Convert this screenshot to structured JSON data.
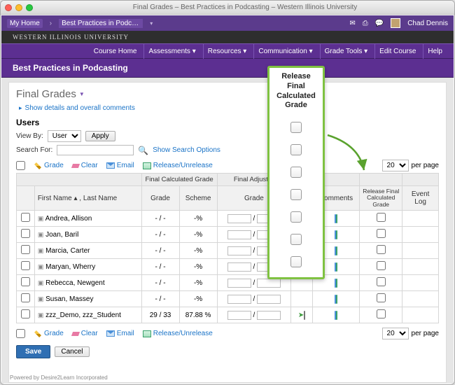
{
  "window_title": "Final Grades – Best Practices in Podcasting – Western Illinois University",
  "topnav": {
    "home": "My Home",
    "breadcrumb": "Best Practices in Podc…",
    "icons": [
      "envelope",
      "chat",
      "speech"
    ],
    "user": "Chad Dennis"
  },
  "university": "WESTERN ILLINOIS UNIVERSITY",
  "navbar2": [
    "Course Home",
    "Assessments ▾",
    "Resources ▾",
    "Communication ▾",
    "Grade Tools ▾",
    "Edit Course",
    "Help"
  ],
  "course_header": "Best Practices in Podcasting",
  "page_title": "Final Grades",
  "show_details": "Show details and overall comments",
  "users_heading": "Users",
  "view_by_label": "View By:",
  "view_by_options": [
    "User"
  ],
  "apply": "Apply",
  "search_for_label": "Search For:",
  "search_value": "",
  "show_search_options": "Show Search Options",
  "tools": {
    "grade": "Grade",
    "clear": "Clear",
    "email": "Email",
    "release": "Release/Unrelease"
  },
  "perpage": {
    "value": "20",
    "suffix": "per page"
  },
  "table": {
    "group_headers": [
      "",
      "Final Calculated Grade",
      "Final Adjusted Grade",
      "",
      "",
      ""
    ],
    "headers": [
      "",
      "First Name ▴ , Last Name",
      "Grade",
      "Scheme",
      "Grade",
      "",
      "Comments",
      "Release Final Calculated Grade",
      "Event Log"
    ],
    "rows": [
      {
        "name": "Andrea, Allison",
        "grade": "- / -",
        "scheme": "-%"
      },
      {
        "name": "Joan, Baril",
        "grade": "- / -",
        "scheme": "-%"
      },
      {
        "name": "Marcia, Carter",
        "grade": "- / -",
        "scheme": "-%"
      },
      {
        "name": "Maryan, Wherry",
        "grade": "- / -",
        "scheme": "-%"
      },
      {
        "name": "Rebecca, Newgent",
        "grade": "- / -",
        "scheme": "-%"
      },
      {
        "name": "Susan, Massey",
        "grade": "- / -",
        "scheme": "-%"
      },
      {
        "name": "zzz_Demo, zzz_Student",
        "grade": "29 / 33",
        "scheme": "87.88 %",
        "demo": true
      }
    ]
  },
  "save": "Save",
  "cancel": "Cancel",
  "powered": "Powered by Desire2Learn Incorporated",
  "callout": {
    "title": "Release Final Calculated Grade",
    "boxes": 7
  }
}
